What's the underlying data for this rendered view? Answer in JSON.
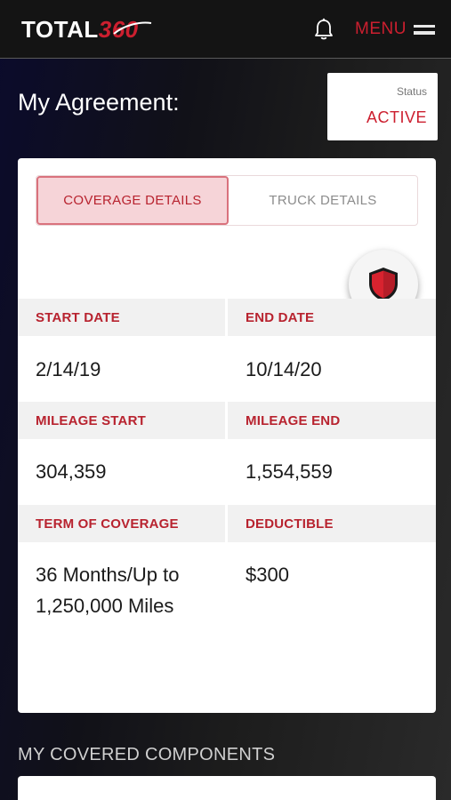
{
  "header": {
    "logo_text": "TOTAL",
    "logo_accent": "360",
    "menu_label": "MENU",
    "icons": {
      "notifications": "bell-icon",
      "menu": "hamburger-icon"
    }
  },
  "page": {
    "title": "My Agreement:",
    "status_label": "Status",
    "status_value": "ACTIVE"
  },
  "tabs": [
    {
      "label": "COVERAGE DETAILS",
      "active": true
    },
    {
      "label": "TRUCK DETAILS",
      "active": false
    }
  ],
  "coverage": {
    "start_date_label": "START DATE",
    "start_date": "2/14/19",
    "end_date_label": "END DATE",
    "end_date": "10/14/20",
    "mileage_start_label": "MILEAGE START",
    "mileage_start": "304,359",
    "mileage_end_label": "MILEAGE END",
    "mileage_end": "1,554,559",
    "term_label": "TERM OF COVERAGE",
    "term": "36 Months/Up to 1,250,000 Miles",
    "deductible_label": "DEDUCTIBLE",
    "deductible": "$300"
  },
  "components": {
    "title": "MY COVERED COMPONENTS"
  },
  "colors": {
    "accent": "#cc1f2f",
    "tab_active_bg": "#f6d4d8",
    "header_bg": "#141414"
  }
}
